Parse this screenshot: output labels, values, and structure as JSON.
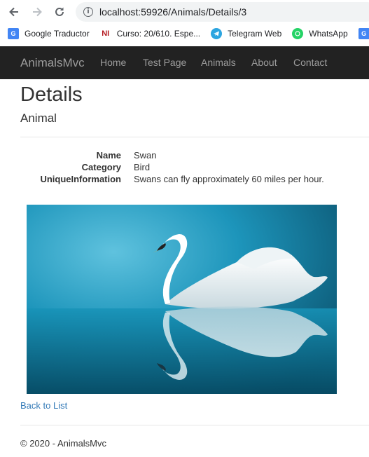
{
  "browser": {
    "url": "localhost:59926/Animals/Details/3",
    "bookmarks": [
      {
        "label": "Google Traductor",
        "icon": "google-translate-icon",
        "color": "#4285f4"
      },
      {
        "label": "Curso: 20/610. Espe...",
        "icon": "ni-icon",
        "color": "#b3171e"
      },
      {
        "label": "Telegram Web",
        "icon": "telegram-icon",
        "color": "#2ca5e0"
      },
      {
        "label": "WhatsApp",
        "icon": "whatsapp-icon",
        "color": "#25d366"
      }
    ]
  },
  "navbar": {
    "brand": "AnimalsMvc",
    "links": [
      "Home",
      "Test Page",
      "Animals",
      "About",
      "Contact"
    ],
    "background": "#222222",
    "link_color": "#9d9d9d"
  },
  "page": {
    "title": "Details",
    "subtitle": "Animal",
    "fields": [
      {
        "label": "Name",
        "value": "Swan"
      },
      {
        "label": "Category",
        "value": "Bird"
      },
      {
        "label": "UniqueInformation",
        "value": "Swans can fly approximately 60 miles per hour."
      }
    ],
    "back_link": "Back to List",
    "footer": "© 2020 - AnimalsMvc",
    "link_color": "#337ab7"
  }
}
